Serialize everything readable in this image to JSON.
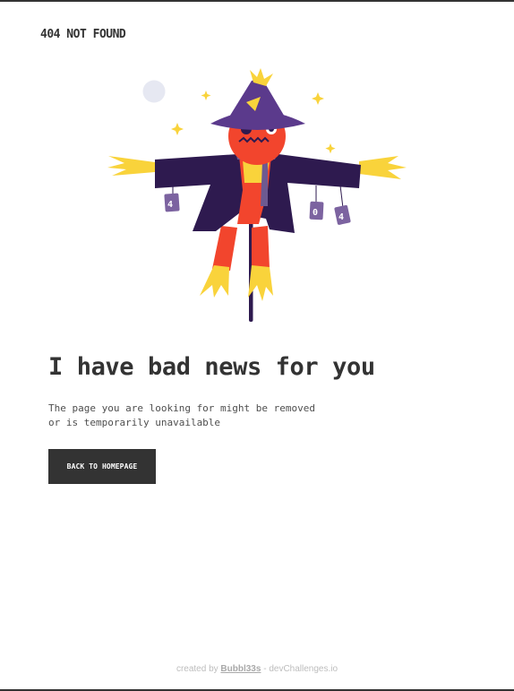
{
  "header": {
    "brand": "404 NOT FOUND"
  },
  "illustration": {
    "name": "scarecrow",
    "can_labels": [
      "4",
      "0",
      "4"
    ],
    "colors": {
      "hat": "#5b3a8c",
      "coat": "#2e1a4f",
      "face": "#f2452d",
      "straw": "#f9d33b",
      "pole": "#2e1a4f",
      "moon": "#e6e8f2",
      "cans": "#7c63a0"
    }
  },
  "main": {
    "headline": "I have bad news for you",
    "description_line1": "The page you are looking for might be removed",
    "description_line2": "or is temporarily unavailable",
    "button_label": "BACK TO HOMEPAGE"
  },
  "footer": {
    "prefix": "created by",
    "author": "Bubbl33s",
    "suffix": "- devChallenges.io"
  },
  "colors": {
    "text": "#333333",
    "button_bg": "#333333",
    "button_text": "#ffffff",
    "footer_text": "#bdbdbd"
  }
}
